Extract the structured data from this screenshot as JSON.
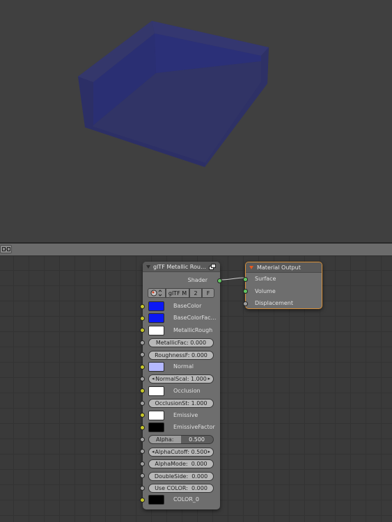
{
  "viewport": {
    "mesh_color": "#2c2f66",
    "wall_color": "#292e72"
  },
  "editor": {
    "header_icon": "node-editor-icon"
  },
  "gltf_node": {
    "title": "glTF Metallic Rou…",
    "header_icon": "node-group-icon",
    "output_label": "Shader",
    "group_selector": {
      "icon": "node-tree-icon",
      "name": "glTF M",
      "users": "2",
      "fake_user": "F"
    },
    "inputs": [
      {
        "label": "BaseColor",
        "kind": "color",
        "socket": "yellow",
        "color": "#0b18f5"
      },
      {
        "label": "BaseColorFac…",
        "kind": "color",
        "socket": "yellow",
        "color": "#0b18f5"
      },
      {
        "label": "MetallicRough",
        "kind": "color",
        "socket": "yellow",
        "color": "#ffffff"
      },
      {
        "label": "MetallicFac: 0.000",
        "kind": "field",
        "socket": "grey"
      },
      {
        "label": "RoughnessF: 0.000",
        "kind": "field",
        "socket": "grey"
      },
      {
        "label": "Normal",
        "kind": "color",
        "socket": "yellow",
        "color": "#b4b8ff"
      },
      {
        "label": "NormalScal: 1.000",
        "kind": "arrows",
        "socket": "grey"
      },
      {
        "label": "Occlusion",
        "kind": "color",
        "socket": "yellow",
        "color": "#ffffff"
      },
      {
        "label": "OcclusionSt: 1.000",
        "kind": "field",
        "socket": "grey"
      },
      {
        "label": "Emissive",
        "kind": "color",
        "socket": "yellow",
        "color": "#ffffff"
      },
      {
        "label": "EmissiveFactor",
        "kind": "color",
        "socket": "yellow",
        "color": "#000000"
      },
      {
        "label": "Alpha:",
        "value": "0.500",
        "kind": "slider",
        "socket": "grey",
        "fraction": 0.5
      },
      {
        "label": "AlphaCutoff: 0.500",
        "kind": "arrows",
        "socket": "grey"
      },
      {
        "label": "AlphaMode:  0.000",
        "kind": "field",
        "socket": "grey"
      },
      {
        "label": "DoubleSide:  0.000",
        "kind": "field",
        "socket": "grey"
      },
      {
        "label": "Use COLOR:  0.000",
        "kind": "field",
        "socket": "grey"
      },
      {
        "label": "COLOR_0",
        "kind": "color",
        "socket": "yellow",
        "color": "#000000"
      }
    ]
  },
  "material_output_node": {
    "title": "Material Output",
    "collapse_color": "#e8581e",
    "selected_border": "#d9913a",
    "inputs": [
      {
        "label": "Surface",
        "socket": "green"
      },
      {
        "label": "Volume",
        "socket": "green"
      },
      {
        "label": "Displacement",
        "socket": "grey"
      }
    ]
  }
}
